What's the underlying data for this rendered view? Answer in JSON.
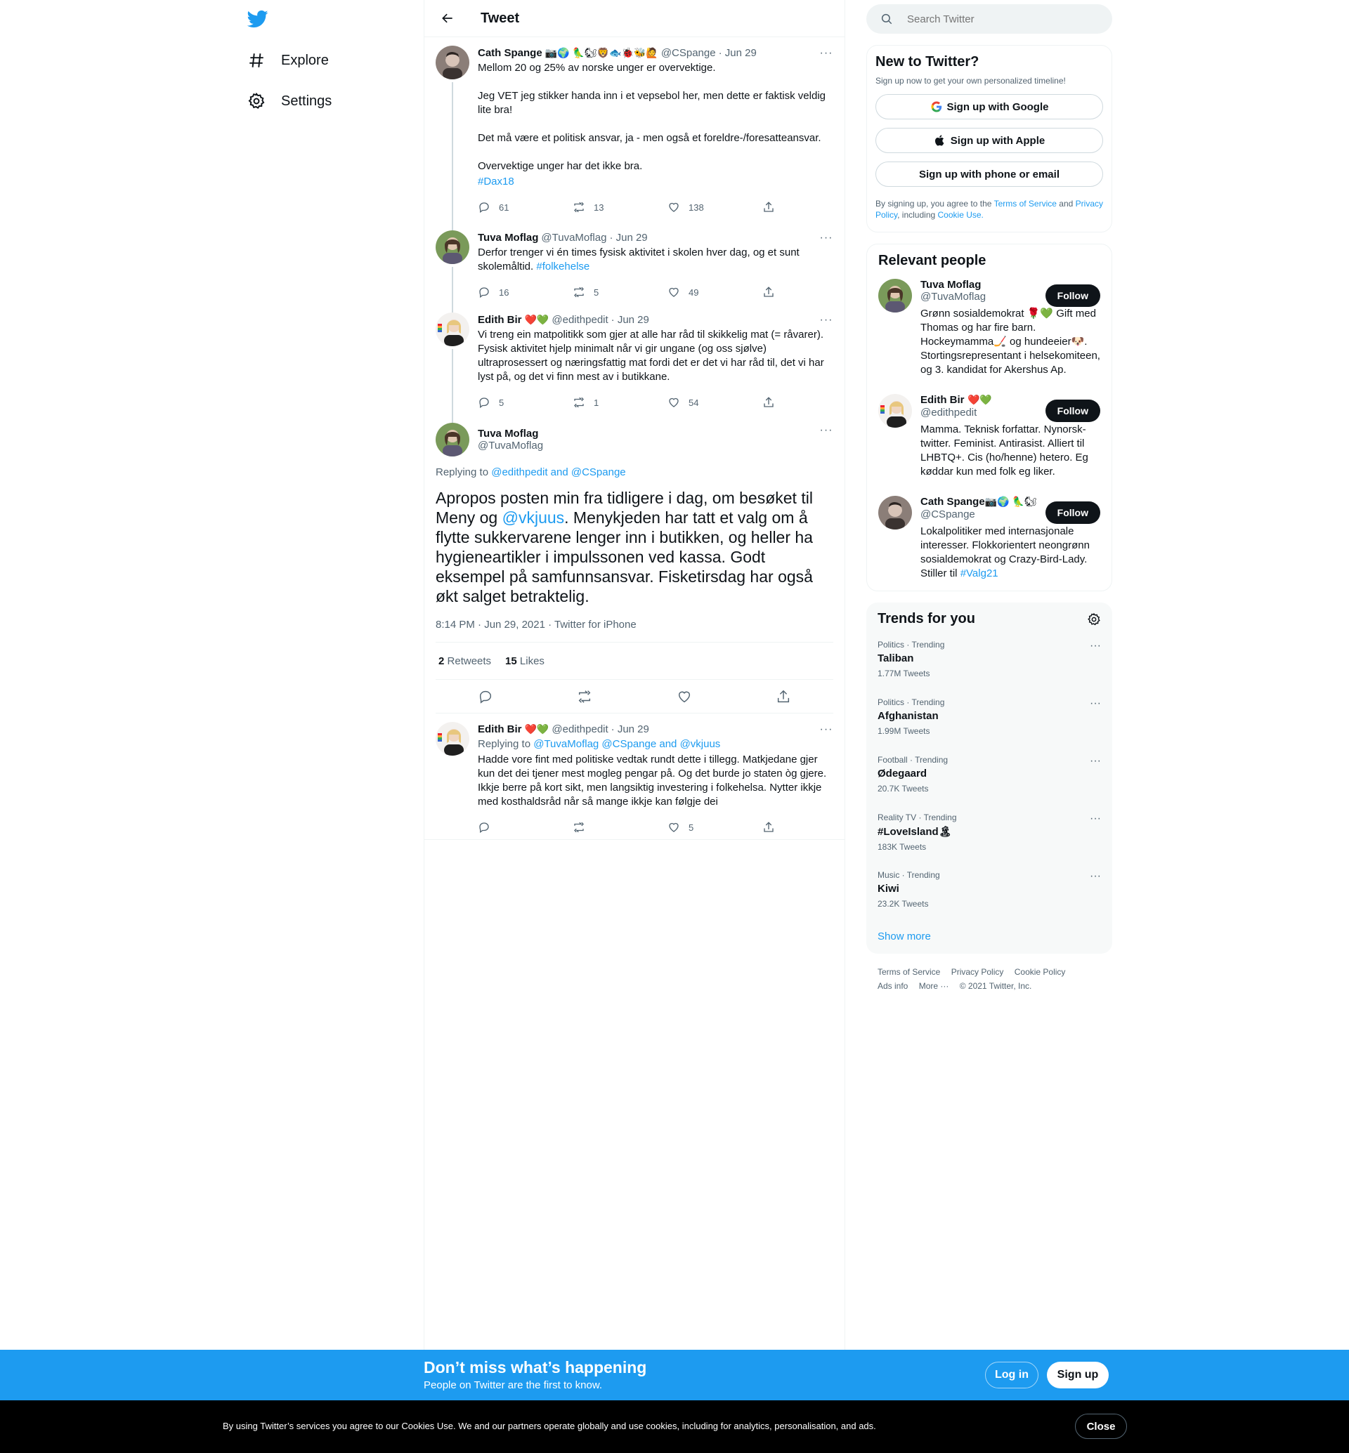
{
  "nav": {
    "explore": "Explore",
    "settings": "Settings"
  },
  "header": {
    "title": "Tweet"
  },
  "thread": [
    {
      "name": "Cath Spange",
      "emojis": "📷🌍 🦜🐿🦁🐟🐞🐝🙋",
      "handle": "@CSpange",
      "date": "· Jun 29",
      "text": "Mellom 20 og 25% av norske unger er overvektige.\n\nJeg VET jeg stikker handa inn i et vepsebol her, men dette er faktisk veldig lite bra!\n\nDet må være et politisk ansvar, ja - men også et foreldre-/foresatteansvar.\n\nOvervektige unger har det ikke bra.",
      "hashtag": "#Dax18",
      "replies": "61",
      "retweets": "13",
      "likes": "138"
    },
    {
      "name": "Tuva Moflag",
      "handle": "@TuvaMoflag",
      "date": "· Jun 29",
      "text": "Derfor trenger vi én times fysisk aktivitet i skolen hver dag, og et sunt skolemåltid.",
      "hashtag": "#folkehelse",
      "replies": "16",
      "retweets": "5",
      "likes": "49"
    },
    {
      "name": "Edith Bir",
      "emojis": "❤️💚",
      "handle": "@edithpedit",
      "date": "· Jun 29",
      "text": "Vi treng ein matpolitikk som gjer at alle har råd til skikkelig mat (= råvarer). Fysisk aktivitet hjelp minimalt når vi gir ungane (og oss sjølve) ultraprosessert og næringsfattig mat fordi det er det vi har råd til, det vi har lyst på, og det vi finn mest av i butikkane.",
      "replies": "5",
      "retweets": "1",
      "likes": "54"
    }
  ],
  "main": {
    "name": "Tuva Moflag",
    "handle": "@TuvaMoflag",
    "replying_prefix": "Replying to",
    "replying_to": "@edithpedit and @CSpange",
    "text_before": "Apropos posten min fra tidligere i dag, om besøket til Meny og ",
    "mention": "@vkjuus",
    "text_after": ". Menykjeden har tatt et valg om å flytte sukkervarene lenger inn i butikken, og heller ha hygieneartikler i impulssonen ved kassa. Godt eksempel på samfunnsansvar. Fisketirsdag har også økt salget betraktelig.",
    "timestamp": "8:14 PM · Jun 29, 2021 · Twitter for iPhone",
    "retweets": "2",
    "retweets_label": "Retweets",
    "likes": "15",
    "likes_label": "Likes"
  },
  "reply": {
    "name": "Edith Bir",
    "emojis": "❤️💚",
    "handle": "@edithpedit",
    "date": "· Jun 29",
    "replying_prefix": "Replying to",
    "replying_to": "@TuvaMoflag @CSpange and @vkjuus",
    "text": "Hadde vore fint med politiske vedtak rundt dette i tillegg. Matkjedane gjer kun det dei tjener mest mogleg pengar på. Og det burde jo staten òg gjere. Ikkje berre på kort sikt, men langsiktig investering i folkehelsa. Nytter ikkje med kosthaldsråd når så mange ikkje kan følgje dei",
    "likes": "5"
  },
  "search": {
    "placeholder": "Search Twitter"
  },
  "new_to_twitter": {
    "title": "New to Twitter?",
    "subtitle": "Sign up now to get your own personalized timeline!",
    "google": "Sign up with Google",
    "apple": "Sign up with Apple",
    "phone": "Sign up with phone or email",
    "legal_1": "By signing up, you agree to the",
    "terms": "Terms of Service",
    "and": "and",
    "privacy": "Privacy Policy",
    "including": ", including",
    "cookie": "Cookie Use."
  },
  "relevant": {
    "title": "Relevant people",
    "follow_label": "Follow",
    "people": [
      {
        "name": "Tuva Moflag",
        "handle": "@TuvaMoflag",
        "bio": "Grønn sosialdemokrat 🌹💚 Gift med Thomas og har fire barn. Hockeymamma🏒 og hundeeier🐶. Stortingsrepresentant i helsekomiteen, og 3. kandidat for Akershus Ap."
      },
      {
        "name": "Edith Bir",
        "emojis": "❤️💚",
        "handle": "@edithpedit",
        "bio": "Mamma. Teknisk forfattar. Nynorsk-twitter. Feminist. Antirasist. Alliert til LHBTQ+. Cis (ho/henne) hetero. Eg køddar kun med folk eg liker."
      },
      {
        "name": "Cath Spange",
        "emojis": "📷🌍 🦜🐿",
        "handle": "@CSpange",
        "bio": "Lokalpolitiker med internasjonale interesser. Flokkorientert neongrønn sosialdemokrat og Crazy-Bird-Lady. Stiller til ",
        "hashtag": "#Valg21"
      }
    ]
  },
  "trends": {
    "title": "Trends for you",
    "items": [
      {
        "category": "Politics · Trending",
        "name": "Taliban",
        "count": "1.77M Tweets"
      },
      {
        "category": "Politics · Trending",
        "name": "Afghanistan",
        "count": "1.99M Tweets"
      },
      {
        "category": "Football · Trending",
        "name": "Ødegaard",
        "count": "20.7K Tweets"
      },
      {
        "category": "Reality TV · Trending",
        "name": "#LoveIsland🏝",
        "count": "183K Tweets"
      },
      {
        "category": "Music · Trending",
        "name": "Kiwi",
        "count": "23.2K Tweets"
      }
    ],
    "show_more": "Show more"
  },
  "footer": {
    "terms": "Terms of Service",
    "privacy": "Privacy Policy",
    "cookie": "Cookie Policy",
    "ads": "Ads info",
    "more": "More ···",
    "copyright": "© 2021 Twitter, Inc."
  },
  "banner": {
    "title": "Don’t miss what’s happening",
    "subtitle": "People on Twitter are the first to know.",
    "login": "Log in",
    "signup": "Sign up"
  },
  "cookie_bar": {
    "text": "By using Twitter’s services you agree to our Cookies Use. We and our partners operate globally and use cookies, including for analytics, personalisation, and ads.",
    "close": "Close"
  },
  "colors": {
    "accent": "#1d9bf0",
    "text": "#0f1419",
    "muted": "#536471",
    "border": "#eff3f4"
  }
}
